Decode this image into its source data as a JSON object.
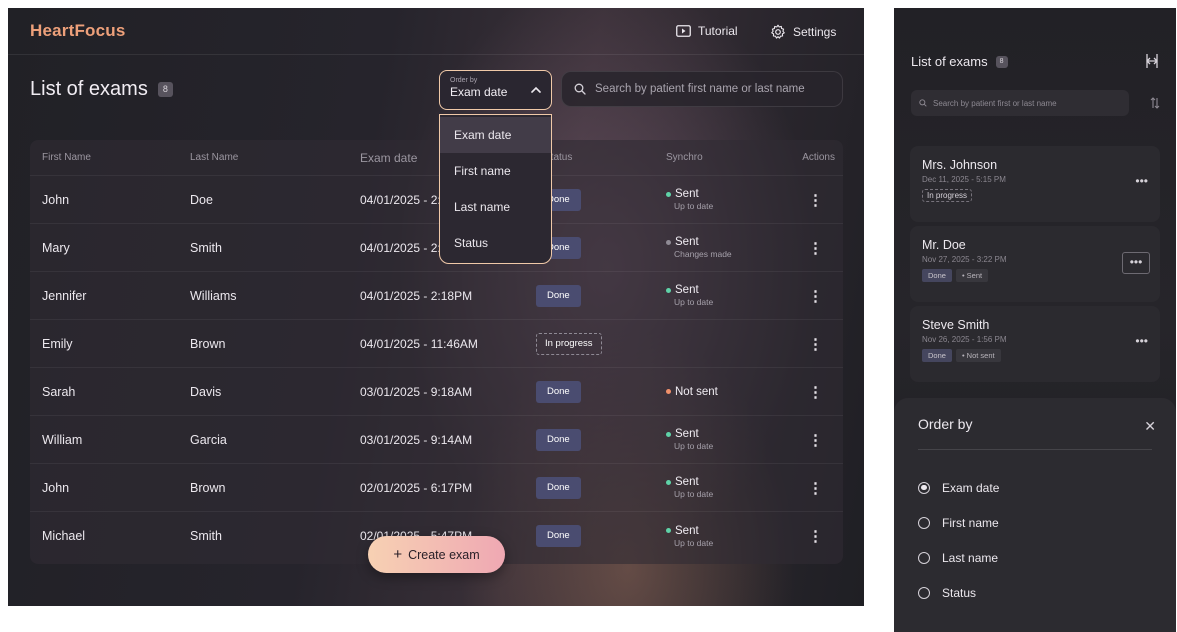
{
  "desktop": {
    "logo": "HeartFocus",
    "header": {
      "tutorial_label": "Tutorial",
      "settings_label": "Settings"
    },
    "title": "List of exams",
    "count": "8",
    "order_by": {
      "caption": "Order by",
      "value": "Exam date",
      "options": [
        "Exam date",
        "First name",
        "Last name",
        "Status"
      ]
    },
    "search_placeholder": "Search by patient first name or last name",
    "table": {
      "headers": [
        "First Name",
        "Last Name",
        "Exam date",
        "Status",
        "Synchro",
        "Actions"
      ],
      "rows": [
        {
          "first": "John",
          "last": "Doe",
          "date": "04/01/2025 - 2:45PM",
          "status": "Done",
          "sync": "Sent",
          "sync_sub": "Up to date"
        },
        {
          "first": "Mary",
          "last": "Smith",
          "date": "04/01/2025 - 2:31PM",
          "status": "Done",
          "sync": "Sent",
          "sync_sub": "Changes made"
        },
        {
          "first": "Jennifer",
          "last": "Williams",
          "date": "04/01/2025 - 2:18PM",
          "status": "Done",
          "sync": "Sent",
          "sync_sub": "Up to date"
        },
        {
          "first": "Emily",
          "last": "Brown",
          "date": "04/01/2025 - 11:46AM",
          "status": "In progress",
          "sync": "",
          "sync_sub": ""
        },
        {
          "first": "Sarah",
          "last": "Davis",
          "date": "03/01/2025 - 9:18AM",
          "status": "Done",
          "sync": "Not sent",
          "sync_sub": ""
        },
        {
          "first": "William",
          "last": "Garcia",
          "date": "03/01/2025 - 9:14AM",
          "status": "Done",
          "sync": "Sent",
          "sync_sub": "Up to date"
        },
        {
          "first": "John",
          "last": "Brown",
          "date": "02/01/2025 - 6:17PM",
          "status": "Done",
          "sync": "Sent",
          "sync_sub": "Up to date"
        },
        {
          "first": "Michael",
          "last": "Smith",
          "date": "02/01/2025 - 5:47PM",
          "status": "Done",
          "sync": "Sent",
          "sync_sub": "Up to date"
        }
      ],
      "actions_glyph": "⋮"
    },
    "create_label": "Create exam",
    "colors": {
      "accent": "#eda07a",
      "done_badge": "#4a4c70",
      "sent_dot": "#5fd3a8",
      "not_sent_dot": "#f0906a",
      "changes_dot": "#8f8b95"
    }
  },
  "mobile": {
    "title": "List of exams",
    "count": "8",
    "search_placeholder": "Search by patient first or last name",
    "cards": [
      {
        "name": "Mrs. Johnson",
        "date": "Dec 11, 2025 - 5:15 PM",
        "tags": [
          "In progress"
        ]
      },
      {
        "name": "Mr. Doe",
        "date": "Nov 27, 2025 - 3:22 PM",
        "tags": [
          "Done",
          "• Sent"
        ]
      },
      {
        "name": "Steve Smith",
        "date": "Nov 26, 2025 - 1:56 PM",
        "tags": [
          "Done",
          "• Not sent"
        ]
      }
    ],
    "more_glyph": "•••",
    "sheet": {
      "title": "Order by",
      "close": "✕",
      "options": [
        "Exam date",
        "First name",
        "Last name",
        "Status"
      ],
      "selected": "Exam date"
    }
  }
}
